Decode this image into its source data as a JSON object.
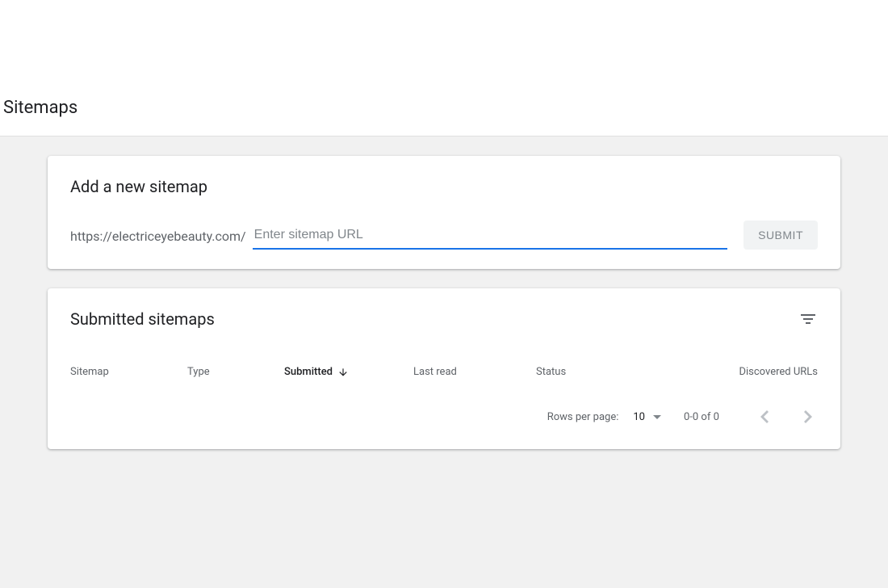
{
  "page": {
    "title": "Sitemaps"
  },
  "addSitemap": {
    "title": "Add a new sitemap",
    "prefixUrl": "https://electriceyebeauty.com/",
    "placeholder": "Enter sitemap URL",
    "value": "",
    "submitLabel": "SUBMIT"
  },
  "submitted": {
    "title": "Submitted sitemaps",
    "columns": {
      "sitemap": "Sitemap",
      "type": "Type",
      "submitted": "Submitted",
      "lastRead": "Last read",
      "status": "Status",
      "discovered": "Discovered URLs"
    },
    "rows": []
  },
  "pagination": {
    "rowsPerPageLabel": "Rows per page:",
    "rowsPerPageValue": "10",
    "rangeText": "0-0 of 0"
  }
}
